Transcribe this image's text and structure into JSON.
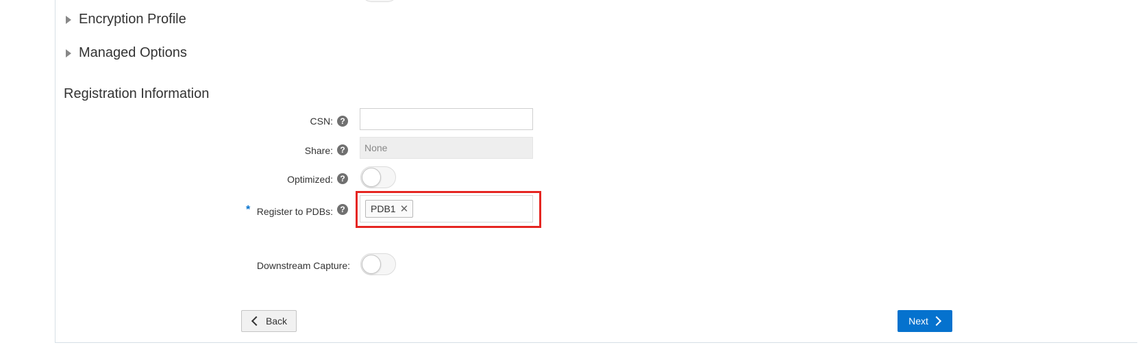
{
  "sections": {
    "encryption_profile": "Encryption Profile",
    "managed_options": "Managed Options",
    "registration_information": "Registration Information"
  },
  "fields": {
    "csn": {
      "label": "CSN:",
      "value": ""
    },
    "share": {
      "label": "Share:",
      "value": "None"
    },
    "optimized": {
      "label": "Optimized:",
      "enabled": false
    },
    "register_to_pdbs": {
      "label": "Register to PDBs:",
      "required_marker": "*",
      "tags": [
        "PDB1"
      ],
      "remove_glyph": "✕"
    },
    "downstream_capture": {
      "label": "Downstream Capture:",
      "enabled": false
    }
  },
  "help_glyph": "?",
  "buttons": {
    "back": "Back",
    "next": "Next"
  },
  "colors": {
    "primary": "#0572ce",
    "highlight_border": "#e52521",
    "required_marker": "#0572ce"
  },
  "icons": {
    "expand": "triangle-right-icon",
    "help": "help-icon",
    "back": "chevron-left-icon",
    "next": "chevron-right-icon",
    "remove": "close-icon"
  }
}
